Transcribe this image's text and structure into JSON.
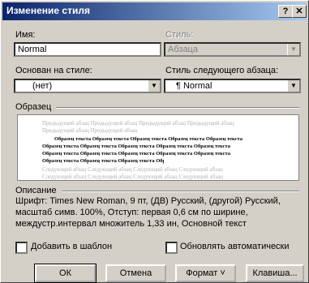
{
  "window": {
    "title": "Изменение стиля",
    "help_label": "?",
    "close_label": "✕"
  },
  "name": {
    "label": "Имя:",
    "value": "Normal"
  },
  "style_type": {
    "label": "Стиль:",
    "value": "Абзаца"
  },
  "based_on": {
    "label": "Основан на стиле:",
    "value": "(нет)"
  },
  "next_style": {
    "label": "Стиль следующего абзаца:",
    "value": "¶ Normal"
  },
  "sample": {
    "label": "Образец",
    "gray_before": "Предыдущий абзац Предыдущий абзац Предыдущий абзац Предыдущий абзац",
    "gray_before2": "Предыдущий абзац Предыдущий абзац",
    "sample_line": "Образец текста Образец текста Образец текста Образец текста Образец текста",
    "gray_after": "Следующий абзац Следующий абзац Следующий абзац Следующий абзац"
  },
  "description": {
    "label": "Описание",
    "text": "Шрифт: Times New Roman, 9 пт, (ДВ) Русский, (другой) Русский, масштаб симв. 100%, Отступ: первая 0,6 см по ширине, междустр.интервал множитель 1,33 ин, Основной текст"
  },
  "add_to_template": {
    "label": "Добавить в шаблон",
    "checked": false
  },
  "auto_update": {
    "label": "Обновлять автоматически",
    "checked": false
  },
  "buttons": {
    "ok": "ОК",
    "cancel": "Отмена",
    "format": "Формат ˅",
    "shortcut": "Клавиша..."
  },
  "icons": {
    "dropdown": "▼"
  }
}
